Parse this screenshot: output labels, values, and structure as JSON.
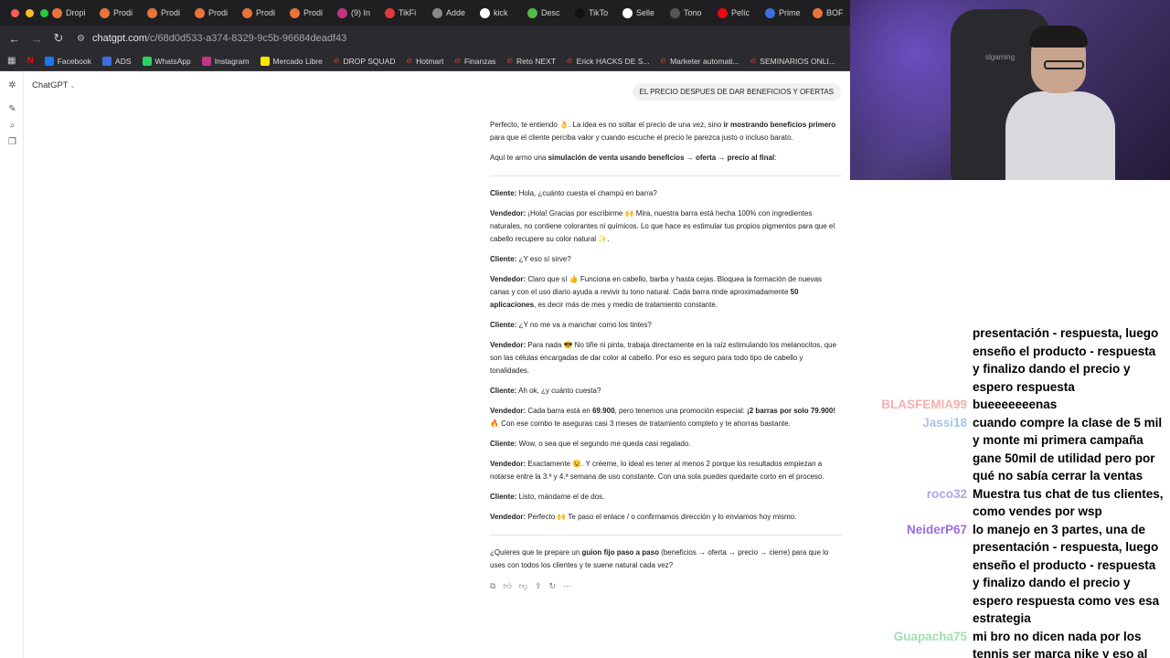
{
  "browser": {
    "tabs": [
      {
        "label": "Dropi",
        "color": "#e8743b"
      },
      {
        "label": "Prodi",
        "color": "#e8743b"
      },
      {
        "label": "Prodi",
        "color": "#e8743b"
      },
      {
        "label": "Prodi",
        "color": "#e8743b"
      },
      {
        "label": "Prodi",
        "color": "#e8743b"
      },
      {
        "label": "Prodi",
        "color": "#e8743b"
      },
      {
        "label": "(9) In",
        "color": "#c13584"
      },
      {
        "label": "TikFi",
        "color": "#e03a3a"
      },
      {
        "label": "Adde",
        "color": "#888888"
      },
      {
        "label": "kick",
        "color": "#ffffff"
      },
      {
        "label": "Desc",
        "color": "#53b848"
      },
      {
        "label": "TikTo",
        "color": "#111111"
      },
      {
        "label": "Selle",
        "color": "#ffffff"
      },
      {
        "label": "Tono",
        "color": "#555555"
      },
      {
        "label": "Pelíc",
        "color": "#e50914"
      },
      {
        "label": "Prime",
        "color": "#3b6fe0"
      },
      {
        "label": "BOF",
        "color": "#e8743b"
      }
    ],
    "url": {
      "host": "chatgpt.com",
      "path": "/c/68d0d533-a374-8329-9c5b-96684deadf43"
    },
    "bookmarks": [
      {
        "label": "Facebook",
        "color": "#1877f2"
      },
      {
        "label": "ADS",
        "color": "#3b6fe0"
      },
      {
        "label": "WhatsApp",
        "color": "#25d366"
      },
      {
        "label": "Instagram",
        "color": "#c13584"
      },
      {
        "label": "Mercado Libre",
        "color": "#ffe600"
      },
      {
        "label": "DROP SQUAD",
        "color": "#e0523a"
      },
      {
        "label": "Hotmart",
        "color": "#e0523a"
      },
      {
        "label": "Finanzas",
        "color": "#e0523a"
      },
      {
        "label": "Reto NEXT",
        "color": "#e0523a"
      },
      {
        "label": "Erick HACKS DE S...",
        "color": "#e0523a"
      },
      {
        "label": "Marketer automati...",
        "color": "#e0523a"
      },
      {
        "label": "SEMINARIOS ONLI...",
        "color": "#e0523a"
      }
    ]
  },
  "app": {
    "brand": "ChatGPT",
    "user_message": "EL PRECIO DESPUES DE DAR BENEFICIOS Y OFERTAS",
    "intro1_a": "Perfecto, te entiendo 👌. La idea es no soltar el precio de una vez, sino ",
    "intro1_b": "ir mostrando beneficios primero",
    "intro1_c": " para que el cliente perciba valor y cuando escuche el precio le parezca justo o incluso barato.",
    "intro2_a": "Aquí te armo una ",
    "intro2_b": "simulación de venta usando beneficios → oferta → precio al final",
    "intro2_c": ":",
    "lines": [
      {
        "who": "Cliente:",
        "text": " Hola, ¿cuánto cuesta el champú en barra?"
      },
      {
        "who": "Vendedor:",
        "text": " ¡Hola! Gracias por escribirme 🙌 Mira, nuestra barra está hecha 100% con ingredientes naturales, no contiene colorantes ni químicos. Lo que hace es estimular tus propios pigmentos para que el cabello recupere su color natural ✨."
      },
      {
        "who": "Cliente:",
        "text": " ¿Y eso sí sirve?"
      },
      {
        "who": "Vendedor:",
        "text": " Claro que sí 👍 Funciona en cabello, barba y hasta cejas. Bloquea la formación de nuevas canas y con el uso diario ayuda a revivir tu tono natural. Cada barra rinde aproximadamente ",
        "bold": "50 aplicaciones",
        "after": ", es decir más de mes y medio de tratamiento constante."
      },
      {
        "who": "Cliente:",
        "text": " ¿Y no me va a manchar como los tintes?"
      },
      {
        "who": "Vendedor:",
        "text": " Para nada 😎 No tiñe ni pinta, trabaja directamente en la raíz estimulando los melanocitos, que son las células encargadas de dar color al cabello. Por eso es seguro para todo tipo de cabello y tonalidades."
      },
      {
        "who": "Cliente:",
        "text": " Ah ok, ¿y cuánto cuesta?"
      },
      {
        "who": "Vendedor:",
        "text": " Cada barra está en ",
        "bold": "69.900",
        "after": ", pero tenemos una promoción especial: ",
        "bold2": "¡2 barras por solo 79.900!",
        "after2": " 🔥 Con ese combo te aseguras casi 3 meses de tratamiento completo y te ahorras bastante."
      },
      {
        "who": "Cliente:",
        "text": " Wow, o sea que el segundo me queda casi regalado."
      },
      {
        "who": "Vendedor:",
        "text": " Exactamente 😉. Y créeme, lo ideal es tener al menos 2 porque los resultados empiezan a notarse entre la 3.ª y 4.ª semana de uso constante. Con una sola puedes quedarte corto en el proceso."
      },
      {
        "who": "Cliente:",
        "text": " Listo, mándame el de dos."
      },
      {
        "who": "Vendedor:",
        "text": " Perfecto 🙌 Te paso el enlace / o confirmamos dirección y lo enviamos hoy mismo."
      }
    ],
    "outro_a": "¿Quieres que te prepare un ",
    "outro_b": "guion fijo paso a paso",
    "outro_c": " (beneficios → oferta → precio → cierre) para que lo uses con todos los clientes y te suene natural cada vez?"
  },
  "webcam": {
    "chair_logo": "slgaming"
  },
  "stream_chat": [
    {
      "user": "",
      "color": "#000000",
      "text": "presentación - respuesta, luego enseño el producto - respuesta y finalizo dando el precio y espero respuesta"
    },
    {
      "user": "BLASFEMIA99",
      "color": "#f3b0b0",
      "text": "bueeeeeeenas"
    },
    {
      "user": "Jassi18",
      "color": "#a8c4e8",
      "text": "cuando compre la clase de 5 mil y monte mi primera campaña gane 50mil de utilidad pero por qué no sabía cerrar la ventas"
    },
    {
      "user": "roco32",
      "color": "#a8a8e8",
      "text": "Muestra tus chat de tus clientes, como vendes por wsp"
    },
    {
      "user": "NeiderP67",
      "color": "#9a6ce0",
      "text": "lo manejo en 3 partes, una de presentación - respuesta, luego enseño el producto - respuesta y finalizo dando el precio y espero respuesta como ves esa estrategia"
    },
    {
      "user": "Guapacha75",
      "color": "#9ee0b0",
      "text": "mi bro no dicen nada por los tennis ser marca nike y eso al ser replicas"
    }
  ]
}
